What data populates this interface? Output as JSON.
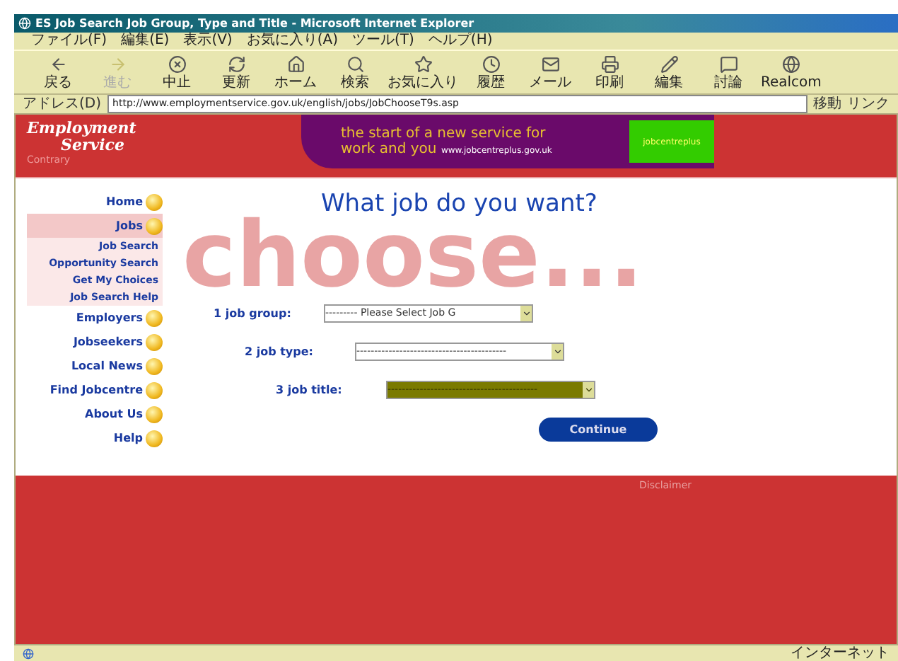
{
  "window": {
    "title": "ES Job Search Job Group, Type and Title - Microsoft Internet Explorer"
  },
  "menu": [
    "ファイル(F)",
    "編集(E)",
    "表示(V)",
    "お気に入り(A)",
    "ツール(T)",
    "ヘルプ(H)"
  ],
  "toolbar": [
    {
      "label": "戻る",
      "disabled": false
    },
    {
      "label": "進む",
      "disabled": true
    },
    {
      "label": "中止",
      "disabled": false
    },
    {
      "label": "更新",
      "disabled": false
    },
    {
      "label": "ホーム",
      "disabled": false
    },
    {
      "label": "検索",
      "disabled": false
    },
    {
      "label": "お気に入り",
      "disabled": false
    },
    {
      "label": "履歴",
      "disabled": false
    },
    {
      "label": "メール",
      "disabled": false
    },
    {
      "label": "印刷",
      "disabled": false
    },
    {
      "label": "編集",
      "disabled": false
    },
    {
      "label": "討論",
      "disabled": false
    },
    {
      "label": "Realcom",
      "disabled": false
    }
  ],
  "address": {
    "label": "アドレス(D)",
    "url": "http://www.employmentservice.gov.uk/english/jobs/JobChooseT9s.asp",
    "go": "移動",
    "links": "リンク"
  },
  "site": {
    "logo_line1": "Employment",
    "logo_line2": "Service",
    "logo_sub": "Contrary",
    "banner_line1": "the start of a new service for",
    "banner_line2": "work and you",
    "banner_url": "www.jobcentreplus.gov.uk",
    "banner_badge": "jobcentreplus"
  },
  "nav": [
    {
      "label": "Home",
      "selected": false
    },
    {
      "label": "Jobs",
      "selected": true,
      "children": [
        {
          "label": "Job Search"
        },
        {
          "label": "Opportunity Search"
        },
        {
          "label": "Get My Choices"
        },
        {
          "label": "Job Search Help"
        }
      ]
    },
    {
      "label": "Employers",
      "selected": false
    },
    {
      "label": "Jobseekers",
      "selected": false
    },
    {
      "label": "Local News",
      "selected": false
    },
    {
      "label": "Find Jobcentre",
      "selected": false
    },
    {
      "label": "About Us",
      "selected": false
    },
    {
      "label": "Help",
      "selected": false
    }
  ],
  "heading": "What job do you want?",
  "hero": "choose...",
  "form": [
    {
      "label": "1 job group:",
      "value": "--------- Please Select Job G",
      "highlighted": false
    },
    {
      "label": "2 job type:",
      "value": "------------------------------------------",
      "highlighted": false
    },
    {
      "label": "3 job title:",
      "value": "------------------------------------------",
      "highlighted": true
    }
  ],
  "continue": "Continue",
  "disclaimer": "Disclaimer",
  "status": {
    "zone": "インターネット"
  }
}
